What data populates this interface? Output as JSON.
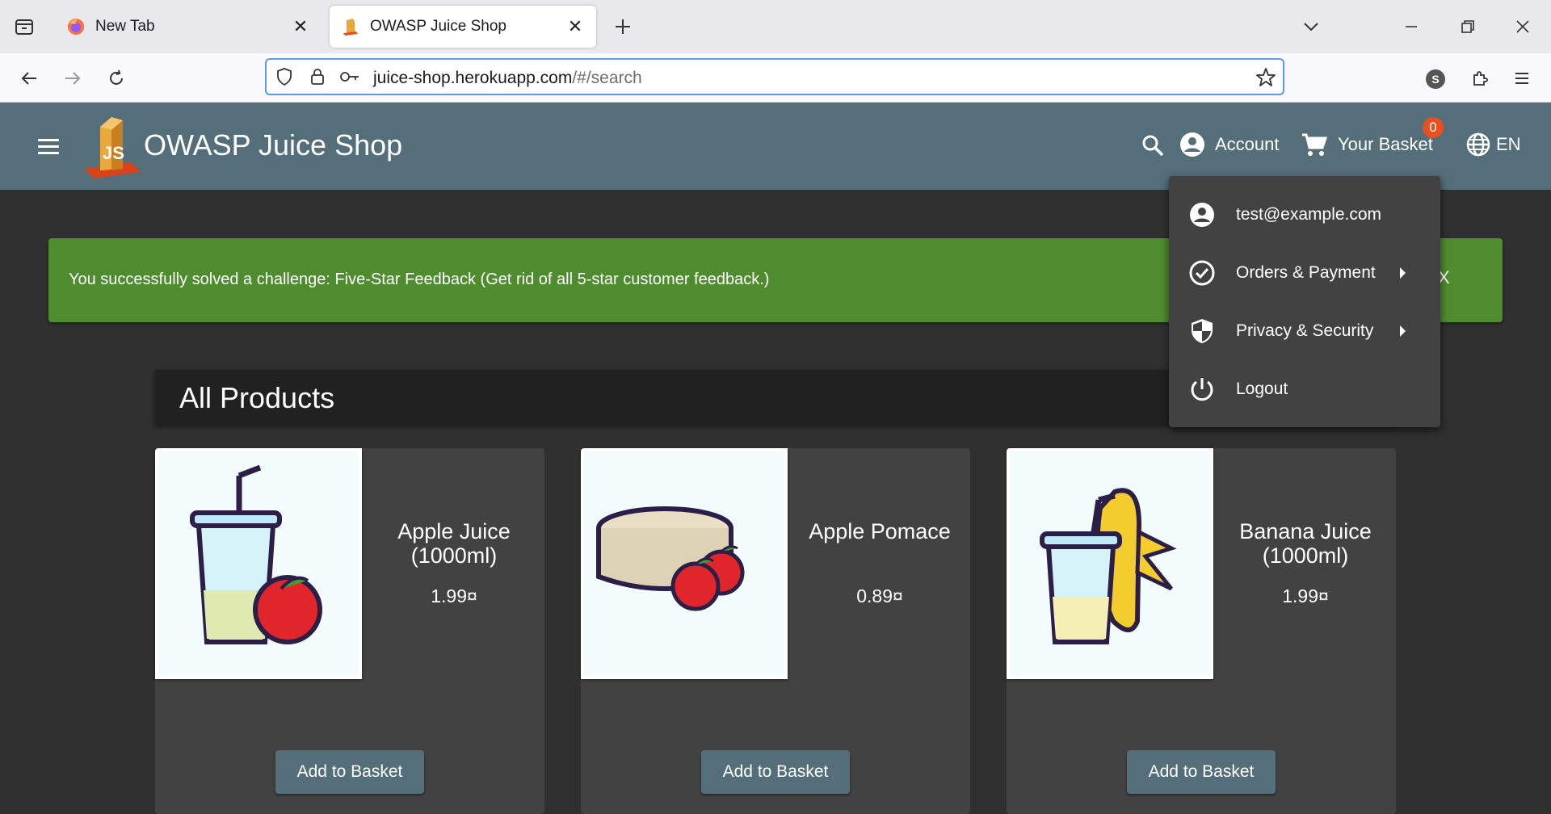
{
  "browser": {
    "tabs": [
      {
        "label": "New Tab",
        "active": false
      },
      {
        "label": "OWASP Juice Shop",
        "active": true
      }
    ],
    "url": {
      "host": "juice-shop.herokuapp.com",
      "path": "/#/search"
    },
    "profile_initial": "S"
  },
  "header": {
    "title": "OWASP Juice Shop",
    "account_label": "Account",
    "basket_label": "Your Basket",
    "basket_count": "0",
    "language": "EN"
  },
  "banner": {
    "message": "You successfully solved a challenge: Five-Star Feedback (Get rid of all 5-star customer feedback.)",
    "close": "X"
  },
  "products": {
    "title": "All Products",
    "items": [
      {
        "name": "Apple Juice (1000ml)",
        "price": "1.99¤",
        "button": "Add to Basket"
      },
      {
        "name": "Apple Pomace",
        "price": "0.89¤",
        "button": "Add to Basket"
      },
      {
        "name": "Banana Juice (1000ml)",
        "price": "1.99¤",
        "button": "Add to Basket"
      }
    ]
  },
  "account_menu": {
    "items": [
      {
        "label": "test@example.com",
        "icon": "account-circle-icon"
      },
      {
        "label": "Orders & Payment",
        "icon": "check-circle-icon"
      },
      {
        "label": "Privacy & Security",
        "icon": "shield-icon"
      },
      {
        "label": "Logout",
        "icon": "power-icon"
      }
    ]
  },
  "colors": {
    "header": "#546e7a",
    "banner": "#4f8c2f",
    "badge": "#e8501e",
    "background": "#303030",
    "card": "#424242"
  }
}
